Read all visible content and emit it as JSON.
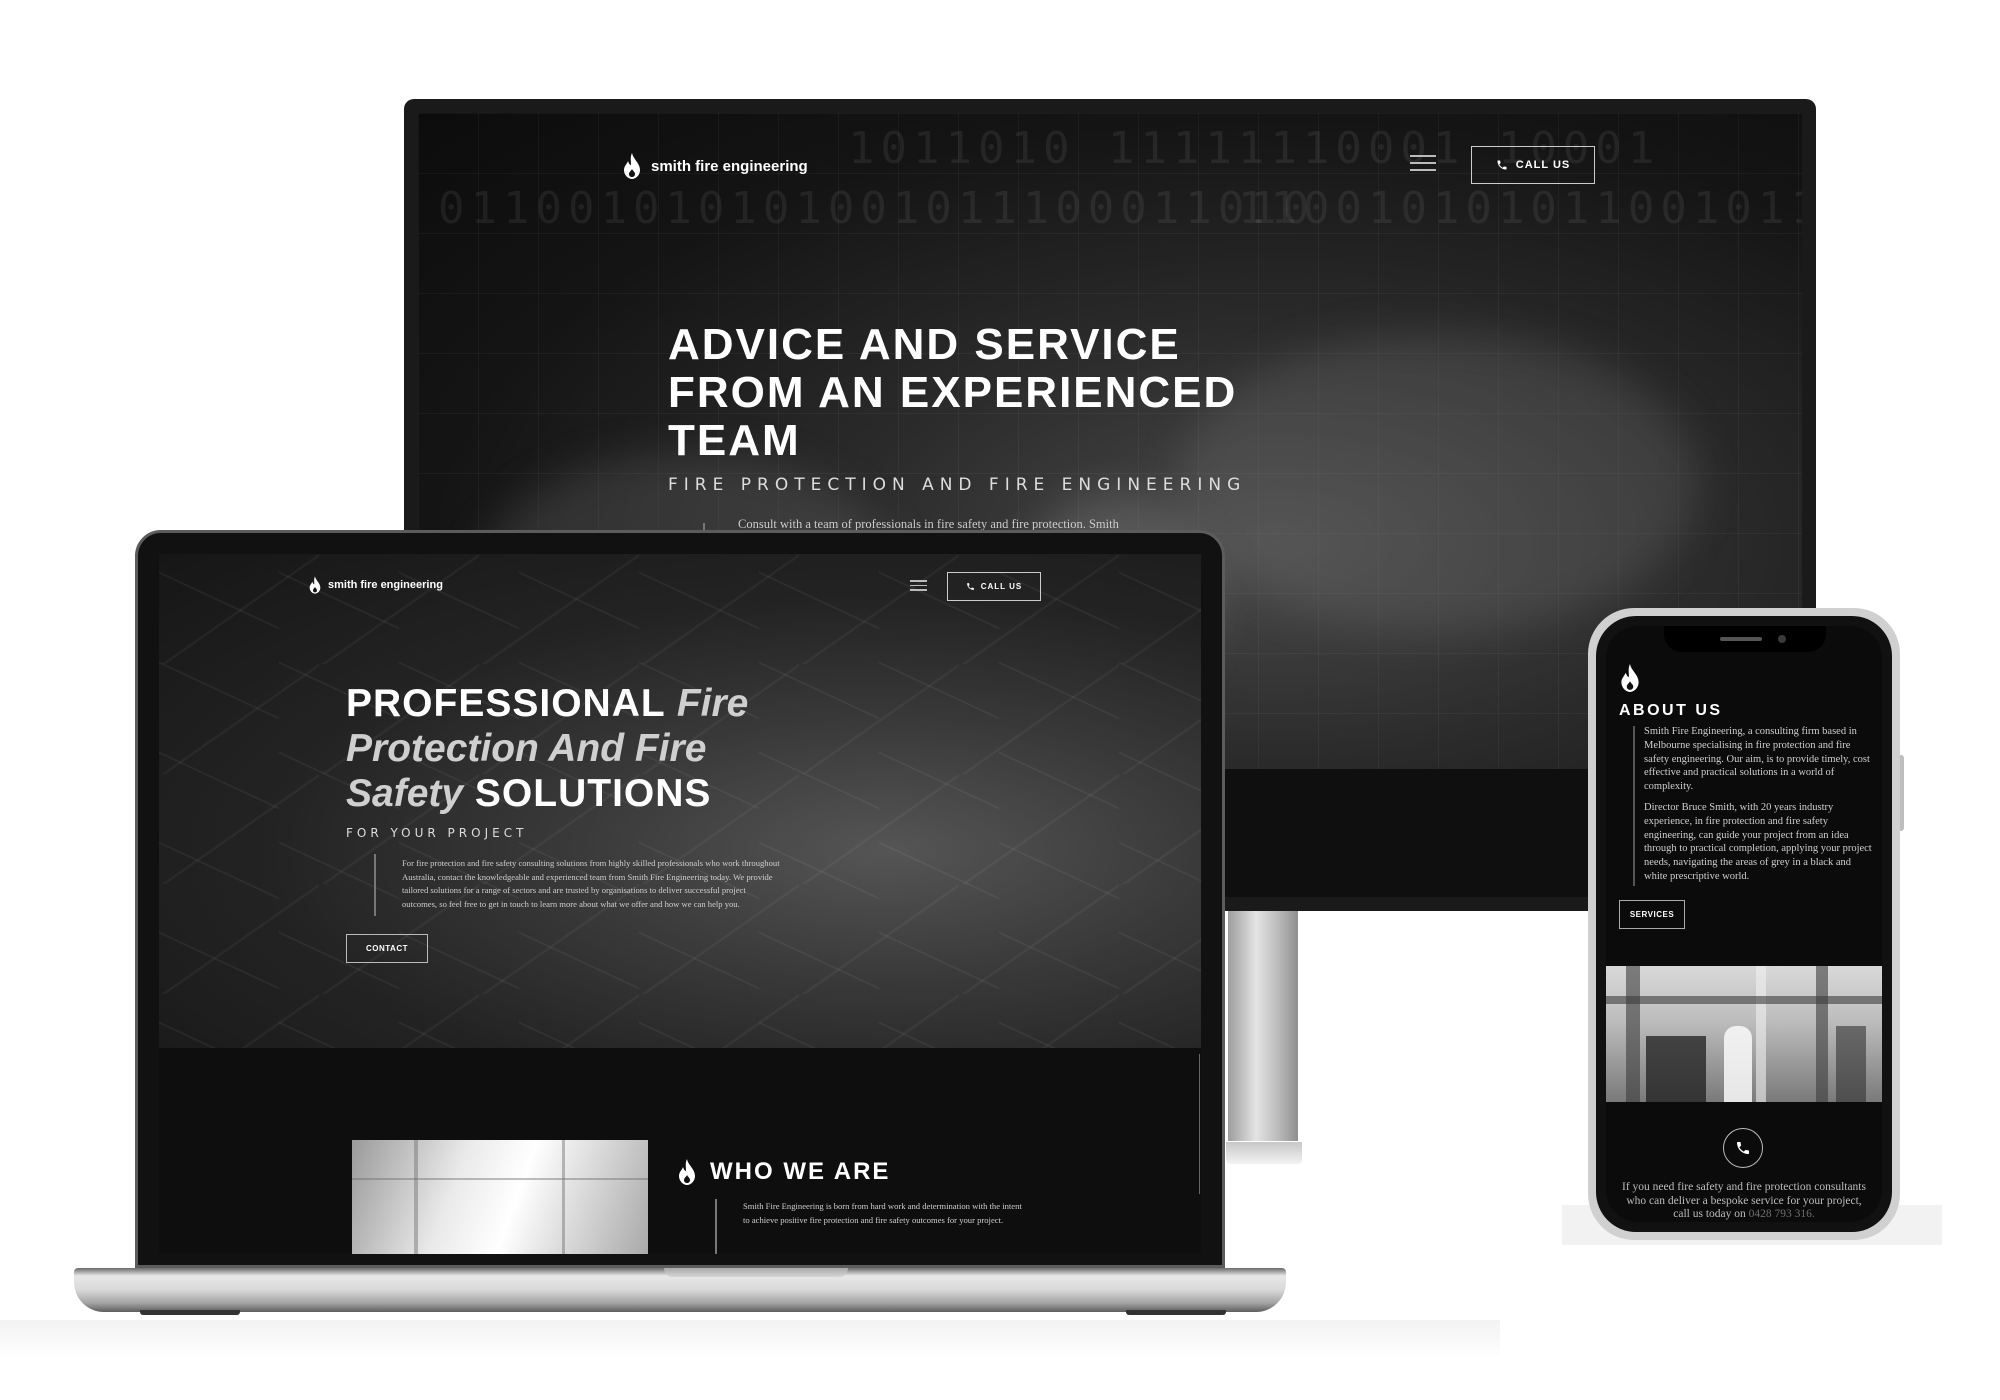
{
  "brand": {
    "name": "smith fire engineering"
  },
  "desktop": {
    "call_label": "CALL US",
    "headline_lines": [
      "ADVICE AND SERVICE",
      "FROM AN EXPERIENCED",
      "TEAM"
    ],
    "subheading": "FIRE PROTECTION AND FIRE ENGINEERING",
    "description": "Consult with a team of professionals in fire safety and fire protection. Smith",
    "binary_rows": [
      "1011010   11111110001   10001",
      "011001010101001011100011010",
      "110010101011001011101011000"
    ]
  },
  "laptop": {
    "call_label": "CALL US",
    "headline": {
      "word1": "PROFESSIONAL",
      "italic1": "Fire",
      "italic2": "Protection And Fire",
      "italic3": "Safety",
      "word2": "SOLUTIONS"
    },
    "subheading": "FOR YOUR PROJECT",
    "description": "For fire protection and fire safety consulting solutions from highly skilled professionals who work throughout Australia, contact the knowledgeable and experienced team from Smith Fire Engineering today. We provide tailored solutions for a range of sectors and are trusted by organisations to deliver successful project outcomes, so feel free to get in touch to learn more about what we offer and how we can help you.",
    "contact_label": "CONTACT",
    "who_title": "WHO WE ARE",
    "who_text": "Smith Fire Engineering is born from hard work and determination with the intent to achieve positive fire protection and fire safety outcomes for your project."
  },
  "phone": {
    "title": "ABOUT US",
    "para1": "Smith Fire Engineering, a consulting firm based in Melbourne specialising in fire protection and fire safety engineering. Our aim, is to provide timely, cost effective and practical solutions in a world of complexity.",
    "para2": "Director Bruce Smith, with 20 years industry experience, in fire protection and fire safety engineering, can guide your project from an idea through to practical completion, applying your project needs, navigating the areas of grey in a black and white prescriptive world.",
    "services_label": "SERVICES",
    "footer_text": "If you need fire safety and fire protection consultants who can deliver a bespoke service for your project, call us today on",
    "phone_number": "0428 793 316."
  }
}
